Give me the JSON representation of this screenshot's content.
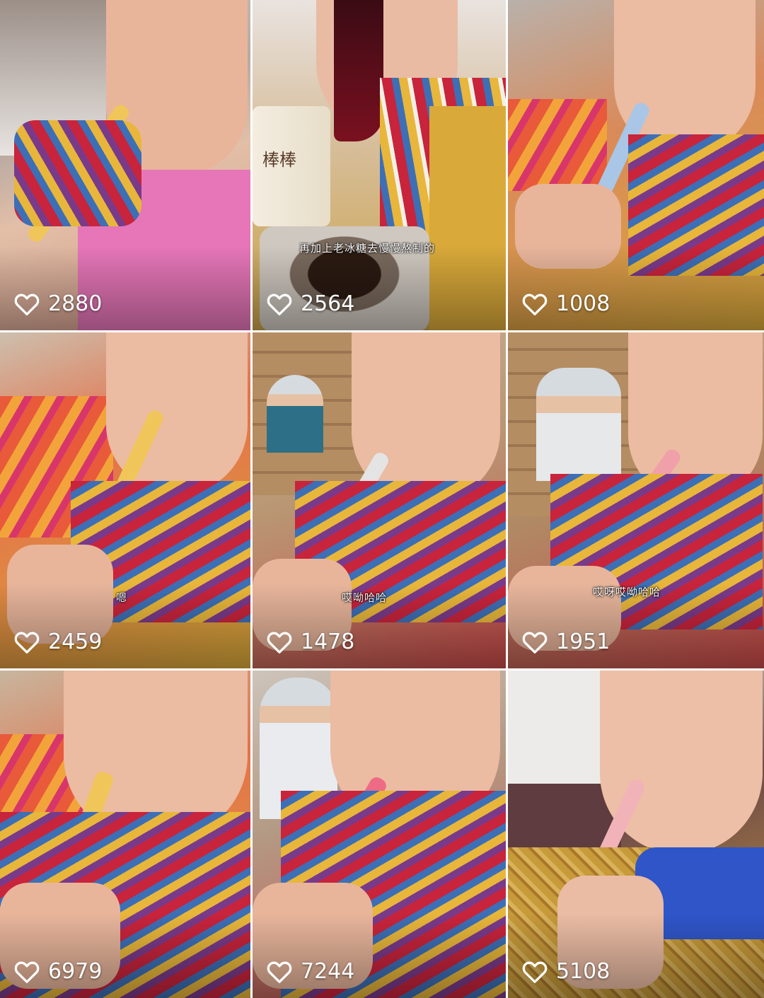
{
  "feed": {
    "videos": [
      {
        "likes": "2880",
        "caption": ""
      },
      {
        "likes": "2564",
        "caption": "再加上老冰糖去慢慢熬制的",
        "jar_label": "棒棒"
      },
      {
        "likes": "1008",
        "caption": ""
      },
      {
        "likes": "2459",
        "caption": "嗯"
      },
      {
        "likes": "1478",
        "caption": "哎呦哈哈"
      },
      {
        "likes": "1951",
        "caption": "哎呀哎呦哈哈"
      },
      {
        "likes": "6979",
        "caption": ""
      },
      {
        "likes": "7244",
        "caption": ""
      },
      {
        "likes": "5108",
        "caption": ""
      }
    ]
  },
  "icons": {
    "like": "heart-outline-icon"
  },
  "colors": {
    "overlay_text": "#ffffff",
    "scarf_red": "#c8243c",
    "scarf_blue": "#3d6fb6",
    "scarf_yellow": "#e8b63a",
    "jacket_yellow": "#d9a93a",
    "pink_bag": "#e676b8"
  }
}
